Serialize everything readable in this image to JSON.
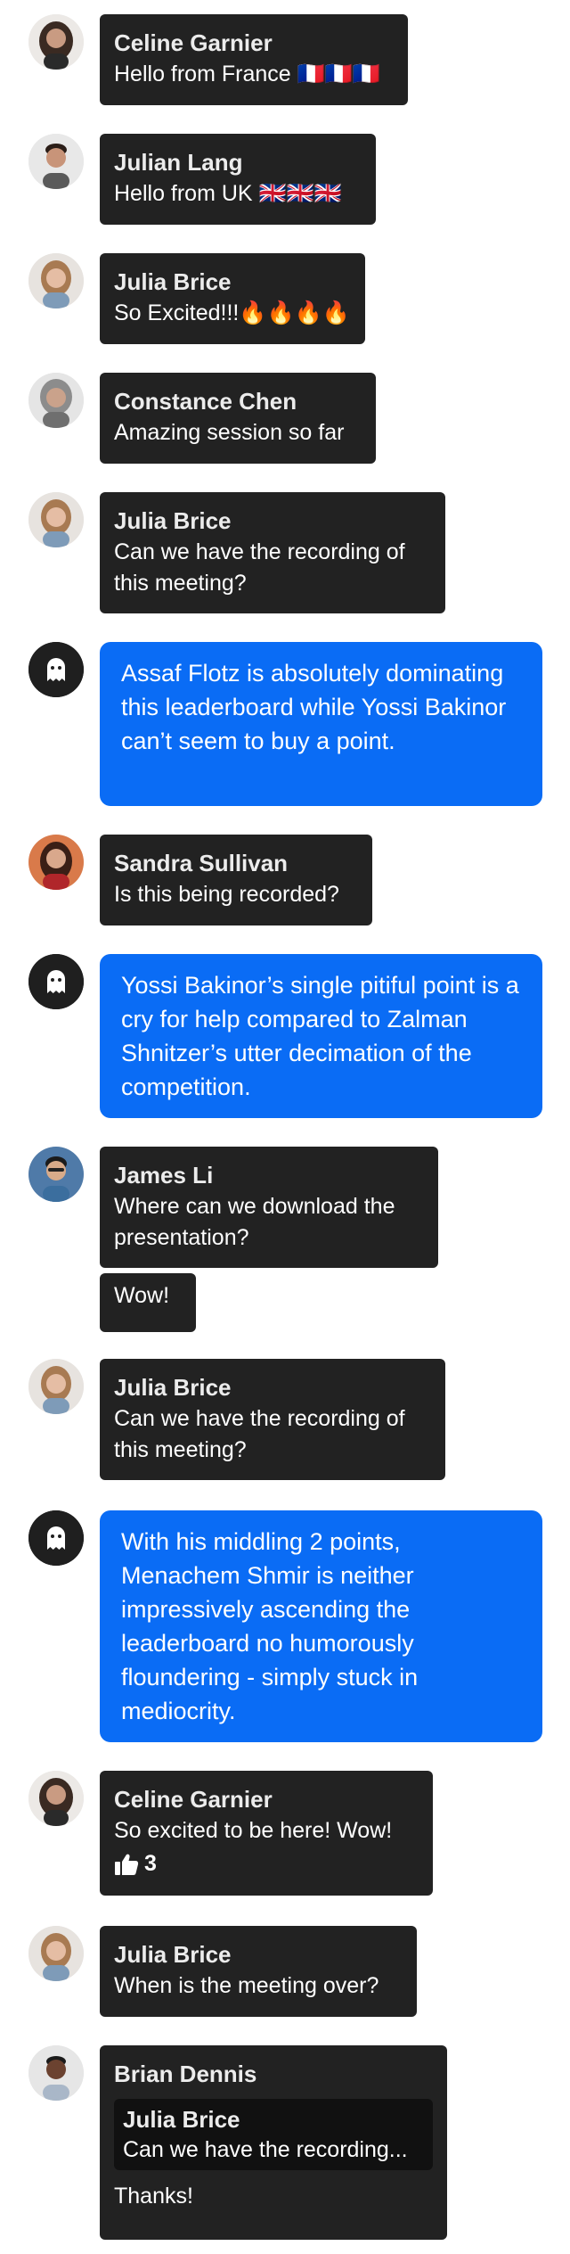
{
  "messages": [
    {
      "name": "Celine Garnier",
      "text": "Hello from France 🇫🇷🇫🇷🇫🇷"
    },
    {
      "name": "Julian Lang",
      "text": "Hello from UK 🇬🇧🇬🇧🇬🇧"
    },
    {
      "name": "Julia Brice",
      "text": "So Excited!!!🔥🔥🔥🔥"
    },
    {
      "name": "Constance Chen",
      "text": "Amazing session so far"
    },
    {
      "name": "Julia Brice",
      "text": "Can we have the recording of this meeting?"
    },
    {
      "text": "Assaf Flotz is absolutely dominating this leaderboard while Yossi Bakinor can’t seem to buy a point."
    },
    {
      "name": "Sandra Sullivan",
      "text": "Is this being recorded?"
    },
    {
      "text": "Yossi Bakinor’s single pitiful point is a cry for help compared to Zalman Shnitzer’s utter decimation of the competition."
    },
    {
      "name": "James Li",
      "text": "Where can we download the presentation?",
      "followup": "Wow!"
    },
    {
      "name": "Julia Brice",
      "text": "Can we have the recording of this meeting?"
    },
    {
      "text": "With his middling 2 points, Menachem Shmir is neither impressively ascending the leaderboard no humorously floundering - simply stuck in mediocrity."
    },
    {
      "name": "Celine Garnier",
      "text": "So excited to be here! Wow!",
      "likes": "3"
    },
    {
      "name": "Julia Brice",
      "text": "When is the meeting over?"
    },
    {
      "name": "Brian Dennis",
      "quote_name": "Julia Brice",
      "quote_text": "Can we have the recording...",
      "text": "Thanks!"
    }
  ],
  "icons": {
    "bot_avatar": "ghost-icon",
    "reaction": "thumbs-up-icon"
  },
  "colors": {
    "bubble": "#222222",
    "bot_bubble": "#0a6cf5"
  }
}
